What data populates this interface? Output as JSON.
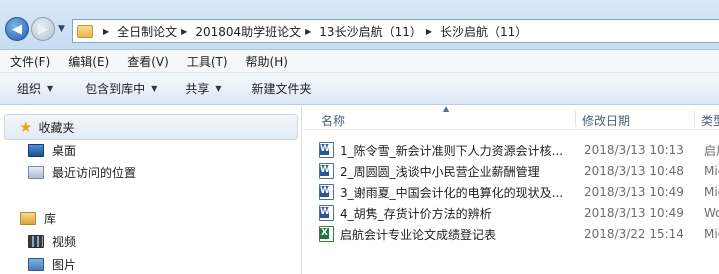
{
  "address_bar": {
    "breadcrumbs": [
      "全日制论文",
      "201804助学班论文",
      "13长沙启航（11）",
      "长沙启航（11）"
    ]
  },
  "menu": [
    "文件(F)",
    "编辑(E)",
    "查看(V)",
    "工具(T)",
    "帮助(H)"
  ],
  "toolbar": {
    "organize": "组织",
    "include_library": "包含到库中",
    "share": "共享",
    "new_folder": "新建文件夹"
  },
  "nav": {
    "favorites_header": "收藏夹",
    "desktop": "桌面",
    "recent": "最近访问的位置",
    "library_header": "库",
    "videos": "视频",
    "pictures": "图片"
  },
  "columns": {
    "name": "名称",
    "date": "修改日期",
    "type": "类型"
  },
  "files": [
    {
      "name": "1_陈令雪_新会计准则下人力资源会计核...",
      "date": "2018/3/13 10:13",
      "type": "启用",
      "icon": "word-icon"
    },
    {
      "name": "2_周圆圆_浅谈中小民营企业薪酬管理",
      "date": "2018/3/13 10:48",
      "type": "Mic",
      "icon": "word-icon"
    },
    {
      "name": "3_谢雨夏_中国会计化的电算化的现状及...",
      "date": "2018/3/13 10:49",
      "type": "Mic",
      "icon": "word-icon"
    },
    {
      "name": "4_胡隽_存货计价方法的辨析",
      "date": "2018/3/13 10:49",
      "type": "Wo",
      "icon": "word-icon"
    },
    {
      "name": "启航会计专业论文成绩登记表",
      "date": "2018/3/22 15:14",
      "type": "Mic",
      "icon": "excel-icon"
    }
  ]
}
